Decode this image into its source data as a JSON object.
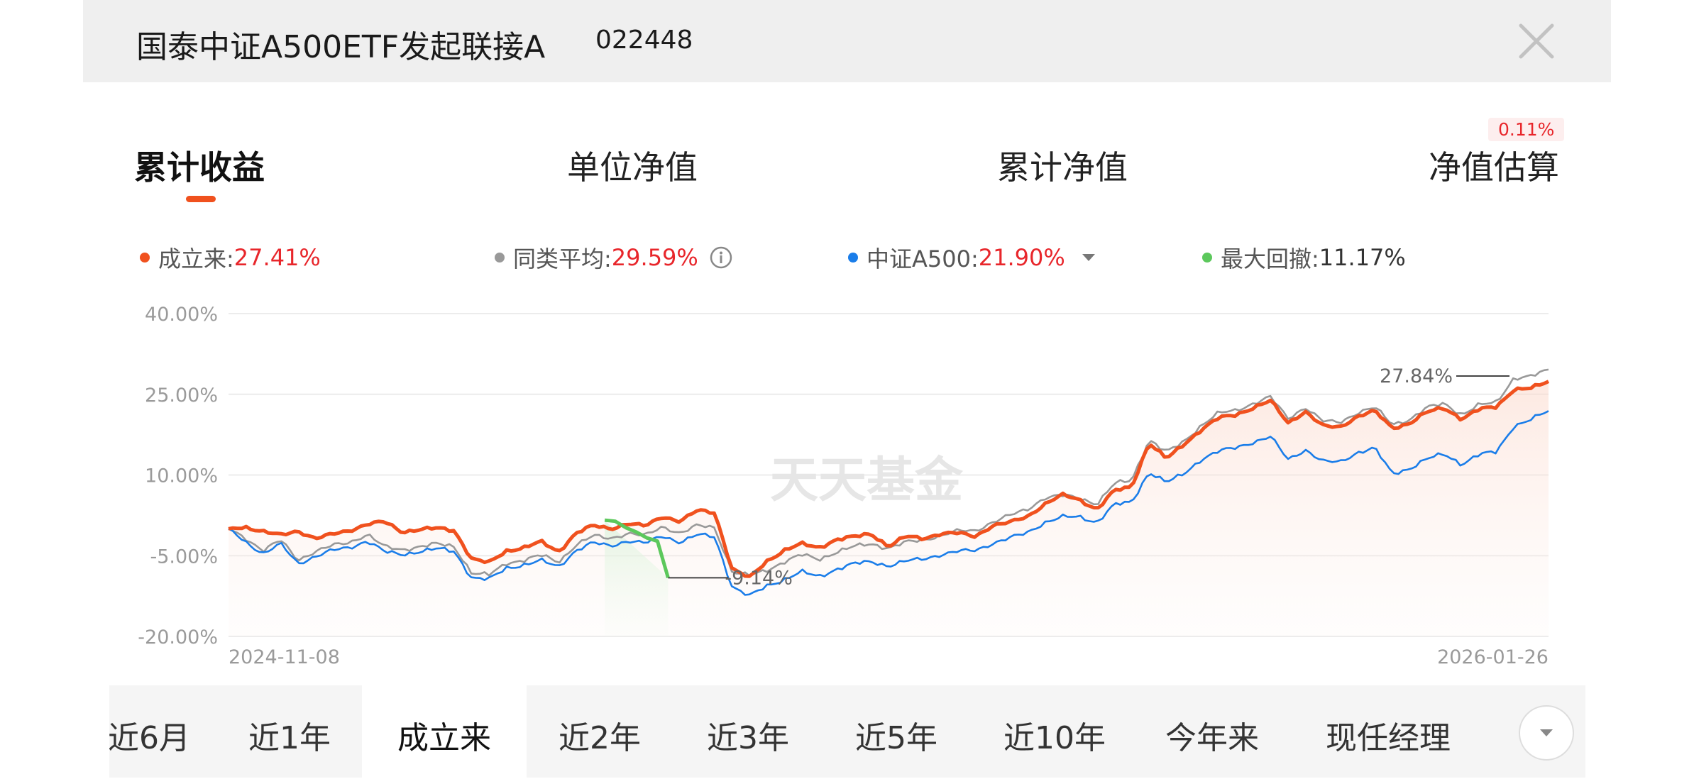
{
  "header": {
    "fund_name": "国泰中证A500ETF发起联接A",
    "fund_code": "022448"
  },
  "tabs": [
    {
      "label": "累计收益",
      "active": true
    },
    {
      "label": "单位净值",
      "active": false
    },
    {
      "label": "累计净值",
      "active": false
    },
    {
      "label": "净值估算",
      "active": false,
      "badge": "0.11%"
    }
  ],
  "legend": {
    "fund": {
      "name": "成立来:",
      "value": "27.41%",
      "color": "#f0511e"
    },
    "peer": {
      "name": "同类平均:",
      "value": "29.59%",
      "color": "#999999",
      "icon": "info-icon"
    },
    "index": {
      "name": "中证A500:",
      "value": "21.90%",
      "color": "#1a7de9",
      "icon": "caret-down-icon"
    },
    "drawdown": {
      "name": "最大回撤:",
      "value": "11.17%",
      "color": "#5cc85c"
    }
  },
  "chart_data": {
    "type": "line",
    "y_tick_labels": [
      "40.00%",
      "25.00%",
      "10.00%",
      "-5.00%",
      "-20.00%"
    ],
    "ylim": [
      -20,
      40
    ],
    "x_labels": [
      "2024-11-08",
      "2026-01-26"
    ],
    "watermark": "天天基金",
    "annotations": [
      {
        "text": "27.84%",
        "series": "同类平均"
      },
      {
        "text": "-9.14%",
        "series": "最大回撤"
      }
    ],
    "series": [
      {
        "name": "成立来",
        "color": "#f0511e",
        "values": [
          0,
          0.3,
          -0.5,
          -1.2,
          -0.4,
          -1.8,
          -1.0,
          -0.3,
          0.9,
          1.3,
          -0.6,
          -0.1,
          0.1,
          -0.3,
          -5.6,
          -6.3,
          -4.1,
          -3.5,
          -2.4,
          -4.3,
          -0.8,
          0.6,
          0.0,
          1.0,
          0.5,
          2.3,
          1.4,
          3.4,
          3.0,
          -7.5,
          -9.1,
          -6.0,
          -4.0,
          -2.8,
          -3.5,
          -2.0,
          -1.5,
          -0.9,
          -3.3,
          -1.4,
          -1.8,
          -0.9,
          -0.8,
          -1.4,
          0.6,
          1.2,
          2.3,
          4.6,
          6.3,
          5.4,
          3.6,
          7.1,
          7.8,
          16.0,
          13.0,
          15.7,
          18.4,
          20.6,
          21.2,
          22.5,
          23.8,
          19.7,
          21.8,
          19.1,
          18.9,
          20.9,
          21.9,
          18.7,
          19.6,
          21.7,
          22.5,
          20.4,
          22.2,
          22.7,
          25.9,
          26.1,
          27.4
        ],
        "n": 77
      },
      {
        "name": "同类平均",
        "color": "#999999",
        "values": [
          0,
          -1.8,
          -4.0,
          -2.1,
          -5.8,
          -4.2,
          -3.1,
          -2.5,
          -1.0,
          -3.4,
          -3.9,
          -3.3,
          -2.8,
          -3.3,
          -8.2,
          -8.6,
          -6.4,
          -5.8,
          -4.9,
          -6.2,
          -3.0,
          -1.3,
          -1.8,
          -0.8,
          -1.3,
          0.4,
          -0.8,
          0.6,
          0.2,
          -8.0,
          -8.7,
          -7.7,
          -6.1,
          -4.8,
          -5.7,
          -4.3,
          -3.3,
          -2.8,
          -3.6,
          -2.5,
          -2.1,
          -1.2,
          -0.4,
          -0.4,
          1.3,
          2.5,
          3.6,
          5.8,
          6.2,
          5.7,
          4.6,
          8.4,
          9.0,
          16.6,
          14.2,
          16.2,
          19.2,
          21.5,
          22.0,
          23.3,
          24.5,
          20.5,
          22.6,
          20.0,
          19.8,
          21.6,
          22.6,
          19.4,
          20.3,
          22.5,
          23.3,
          21.2,
          23.0,
          23.5,
          28.0,
          28.3,
          29.6
        ],
        "n": 77
      },
      {
        "name": "中证A500",
        "color": "#1a7de9",
        "values": [
          0,
          -2.5,
          -4.6,
          -2.8,
          -6.5,
          -5.1,
          -4.0,
          -3.5,
          -2.2,
          -4.3,
          -4.8,
          -4.2,
          -3.7,
          -4.2,
          -9.1,
          -9.4,
          -7.3,
          -6.7,
          -5.9,
          -7.1,
          -4.0,
          -2.6,
          -3.2,
          -2.2,
          -2.7,
          -1.3,
          -2.5,
          -1.1,
          -1.5,
          -10.8,
          -12.5,
          -10.6,
          -9.4,
          -8.0,
          -8.9,
          -7.5,
          -6.5,
          -6.1,
          -6.9,
          -6.0,
          -5.6,
          -4.8,
          -4.2,
          -4.0,
          -2.7,
          -1.7,
          -0.7,
          1.2,
          2.2,
          2.2,
          1.2,
          4.5,
          4.9,
          10.6,
          8.6,
          10.2,
          12.9,
          14.4,
          15.1,
          16.1,
          17.1,
          12.9,
          14.7,
          12.5,
          12.4,
          14.2,
          15.0,
          10.2,
          11.2,
          13.0,
          13.9,
          12.0,
          13.8,
          14.3,
          19.1,
          20.3,
          21.9
        ],
        "n": 77
      },
      {
        "name": "最大回撤",
        "color": "#5cc85c",
        "segment_percent_range": [
          28.5,
          33.3
        ],
        "values": [
          1.6,
          1.4,
          0.2,
          -0.6,
          -1.7,
          -2.3,
          -9.1
        ]
      }
    ]
  },
  "periods": [
    {
      "label": "近6月",
      "active": false
    },
    {
      "label": "近1年",
      "active": false
    },
    {
      "label": "成立来",
      "active": true
    },
    {
      "label": "近2年",
      "active": false
    },
    {
      "label": "近3年",
      "active": false
    },
    {
      "label": "近5年",
      "active": false
    },
    {
      "label": "近10年",
      "active": false
    },
    {
      "label": "今年来",
      "active": false
    },
    {
      "label": "现任经理",
      "active": false
    }
  ]
}
